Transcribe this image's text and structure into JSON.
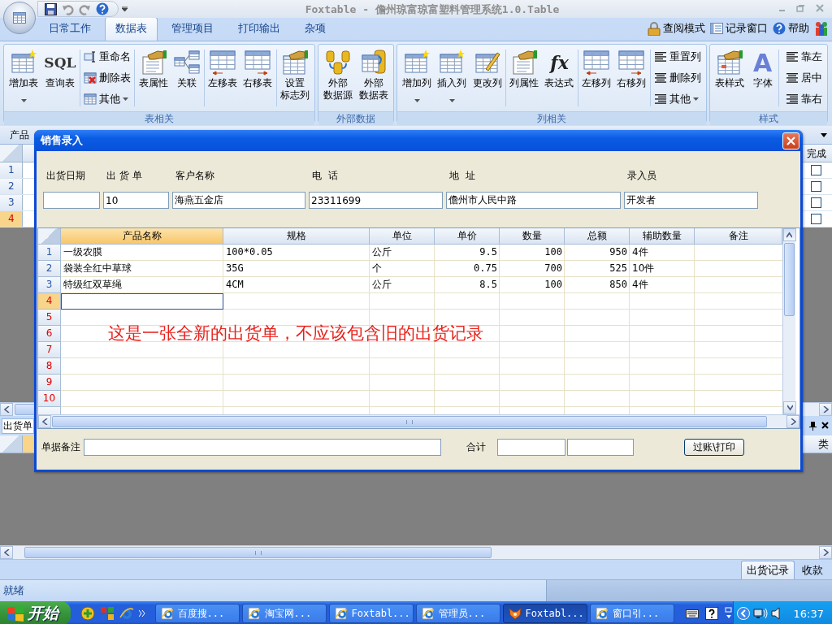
{
  "title_bar": {
    "title": "Foxtable - 儋州琼富琼富塑料管理系统1.0.Table"
  },
  "ribbon_tabs": [
    {
      "label": "日常工作",
      "selected": false
    },
    {
      "label": "数据表",
      "selected": true
    },
    {
      "label": "管理项目",
      "selected": false
    },
    {
      "label": "打印输出",
      "selected": false
    },
    {
      "label": "杂项",
      "selected": false
    }
  ],
  "ribbon_links": [
    {
      "label": "查阅模式"
    },
    {
      "label": "记录窗口"
    },
    {
      "label": "帮助"
    }
  ],
  "ribbon_groups": [
    {
      "title": "表相关",
      "items": [
        {
          "kind": "large",
          "lines": [
            "增加表"
          ],
          "dropdown": true
        },
        {
          "kind": "large",
          "lines": [
            "查询表"
          ],
          "icon_text": "SQL",
          "dropdown": false
        },
        {
          "kind": "stack",
          "buttons": [
            {
              "label": "重命名",
              "dropdown": false
            },
            {
              "label": "删除表",
              "dropdown": false
            },
            {
              "label": "其他",
              "dropdown": true
            }
          ]
        },
        {
          "kind": "large",
          "lines": [
            "表属性"
          ],
          "dropdown": false
        },
        {
          "kind": "large",
          "lines": [
            "关联"
          ],
          "dropdown": false
        },
        {
          "kind": "large",
          "lines": [
            "左移表"
          ],
          "dropdown": false
        },
        {
          "kind": "large",
          "lines": [
            "右移表"
          ],
          "dropdown": false
        },
        {
          "kind": "large",
          "lines": [
            "设置",
            "标志列"
          ],
          "dropdown": false
        }
      ]
    },
    {
      "title": "外部数据",
      "items": [
        {
          "kind": "large",
          "lines": [
            "外部",
            "数据源"
          ],
          "dropdown": false
        },
        {
          "kind": "large",
          "lines": [
            "外部",
            "数据表"
          ],
          "dropdown": false
        }
      ]
    },
    {
      "title": "列相关",
      "items": [
        {
          "kind": "large",
          "lines": [
            "增加列"
          ],
          "dropdown": true
        },
        {
          "kind": "large",
          "lines": [
            "插入列"
          ],
          "dropdown": true
        },
        {
          "kind": "large",
          "lines": [
            "更改列"
          ],
          "dropdown": false
        },
        {
          "kind": "large",
          "lines": [
            "列属性"
          ],
          "dropdown": false
        },
        {
          "kind": "large",
          "lines": [
            "表达式"
          ],
          "icon_text": "fx",
          "dropdown": false
        },
        {
          "kind": "large",
          "lines": [
            "左移列"
          ],
          "dropdown": false
        },
        {
          "kind": "large",
          "lines": [
            "右移列"
          ],
          "dropdown": false
        },
        {
          "kind": "stack",
          "buttons": [
            {
              "label": "重置列",
              "dropdown": false
            },
            {
              "label": "删除列",
              "dropdown": false
            },
            {
              "label": "其他",
              "dropdown": true
            }
          ]
        }
      ]
    },
    {
      "title": "样式",
      "items": [
        {
          "kind": "large",
          "lines": [
            "表样式"
          ],
          "dropdown": false
        },
        {
          "kind": "large",
          "lines": [
            "字体"
          ],
          "icon_text": "A",
          "dropdown": false
        },
        {
          "kind": "stack",
          "buttons": [
            {
              "label": "靠左",
              "dropdown": false
            },
            {
              "label": "居中",
              "dropdown": false
            },
            {
              "label": "靠右",
              "dropdown": false
            }
          ]
        }
      ]
    }
  ],
  "sheet": {
    "tab": "产品",
    "columns": [
      {
        "label": "完成"
      }
    ],
    "rows": [
      {
        "number": "1",
        "done": false,
        "current": false
      },
      {
        "number": "2",
        "done": false,
        "current": false
      },
      {
        "number": "3",
        "done": false,
        "current": false
      },
      {
        "number": "4",
        "done": false,
        "current": true
      }
    ]
  },
  "lower_panel": {
    "title": "出货单",
    "column_partial": "类"
  },
  "dialog": {
    "title": "销售录入",
    "fields": [
      {
        "label": "出货日期"
      },
      {
        "label": "出 货 单",
        "value": "10"
      },
      {
        "label": "客户名称",
        "value": "海燕五金店"
      },
      {
        "label": "电  话",
        "value": "23311699"
      },
      {
        "label": "地  址",
        "value": "儋州市人民中路"
      },
      {
        "label": "录入员",
        "value": "开发者"
      }
    ],
    "grid": {
      "columns": [
        {
          "label": "产品名称",
          "selected": true
        },
        {
          "label": "规格",
          "selected": false
        },
        {
          "label": "单位",
          "selected": false
        },
        {
          "label": "单价",
          "selected": false
        },
        {
          "label": "数量",
          "selected": false
        },
        {
          "label": "总额",
          "selected": false
        },
        {
          "label": "辅助数量",
          "selected": false
        },
        {
          "label": "备注",
          "selected": false
        }
      ],
      "rows": [
        {
          "number": "1",
          "new": false,
          "current": false,
          "cells": [
            "一级农膜",
            "100*0.05",
            "公斤",
            "9.5",
            "100",
            "950",
            "4件"
          ]
        },
        {
          "number": "2",
          "new": false,
          "current": false,
          "cells": [
            "袋装全红中草球",
            "35G",
            "个",
            "0.75",
            "700",
            "525",
            "10件"
          ]
        },
        {
          "number": "3",
          "new": false,
          "current": false,
          "cells": [
            "特级红双草绳",
            "4CM",
            "公斤",
            "8.5",
            "100",
            "850",
            "4件"
          ]
        },
        {
          "number": "4",
          "new": true,
          "current": true
        },
        {
          "number": "5",
          "new": true,
          "current": false
        },
        {
          "number": "6",
          "new": true,
          "current": false
        },
        {
          "number": "7",
          "new": true,
          "current": false
        },
        {
          "number": "8",
          "new": true,
          "current": false
        },
        {
          "number": "9",
          "new": true,
          "current": false
        },
        {
          "number": "10",
          "new": true,
          "current": false
        }
      ],
      "annotation": "这是一张全新的出货单，不应该包含旧的出货记录"
    },
    "remark_label": "单据备注",
    "total_label": "合计",
    "button": "过账\\打印"
  },
  "bottom_tabs": [
    {
      "label": "出货记录",
      "selected": true
    },
    {
      "label": "收款",
      "selected": false
    }
  ],
  "status_bar": {
    "text": "就绪"
  },
  "taskbar": {
    "start": "开始",
    "tasks": [
      {
        "label": "百度搜...",
        "kind": "browser",
        "selected": false
      },
      {
        "label": "淘宝网...",
        "kind": "browser",
        "selected": false
      },
      {
        "label": "Foxtabl...",
        "kind": "browser",
        "selected": false
      },
      {
        "label": "管理员...",
        "kind": "browser",
        "selected": false
      },
      {
        "label": "Foxtabl...",
        "kind": "app",
        "selected": true
      },
      {
        "label": "窗口引...",
        "kind": "browser",
        "selected": false
      }
    ],
    "clock": "16:37"
  }
}
